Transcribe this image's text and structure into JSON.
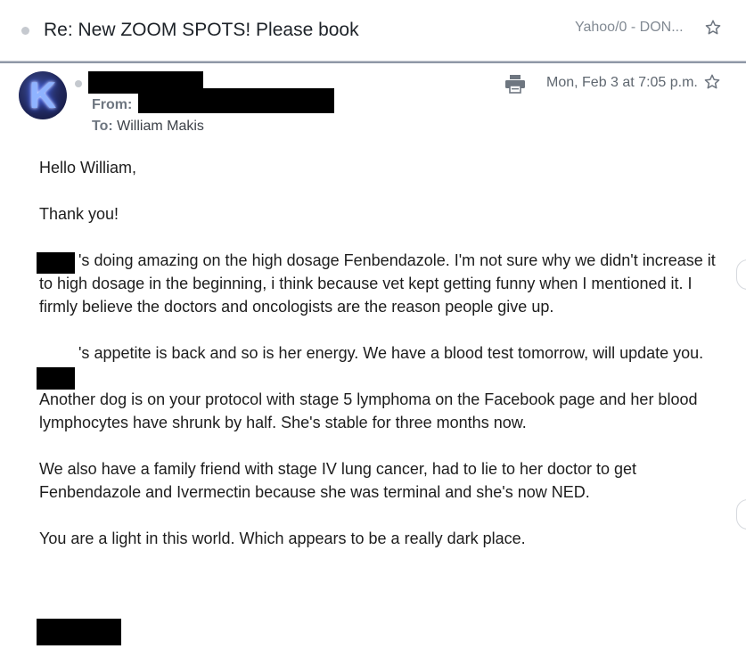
{
  "thread": {
    "subject": "Re: New ZOOM SPOTS! Please book",
    "folder": "Yahoo/0 - DON..."
  },
  "message": {
    "avatar_letter": "K",
    "from_label": "From:",
    "to_label": "To:",
    "to_name": "William Makis",
    "date": "Mon, Feb 3 at 7:05 p.m."
  },
  "body": {
    "greeting": "Hello William,",
    "thanks": "Thank you!",
    "p1": "'s doing amazing on the high dosage Fenbendazole. I'm not sure why we didn't increase it to high dosage in the beginning, i think because vet kept getting funny when I mentioned it. I firmly believe the doctors and oncologists are the reason people give up.",
    "p2": "'s appetite is back and so is her energy. We have a blood test tomorrow, will update you.",
    "p3": "Another dog is on your protocol with stage 5 lymphoma on the Facebook page and her blood lymphocytes have shrunk by half. She's stable for three months now.",
    "p4": "We also have a family friend with stage IV lung cancer, had to lie to her doctor to get Fenbendazole and Ivermectin because she was terminal and she's now NED.",
    "p5": "You are a light in this world. Which appears to be a really dark place."
  },
  "icons": {
    "star": "star-outline-icon",
    "print": "printer-icon"
  },
  "colors": {
    "divider": "#8f98a6",
    "muted_text": "#6e7680",
    "redaction": "#000000"
  }
}
